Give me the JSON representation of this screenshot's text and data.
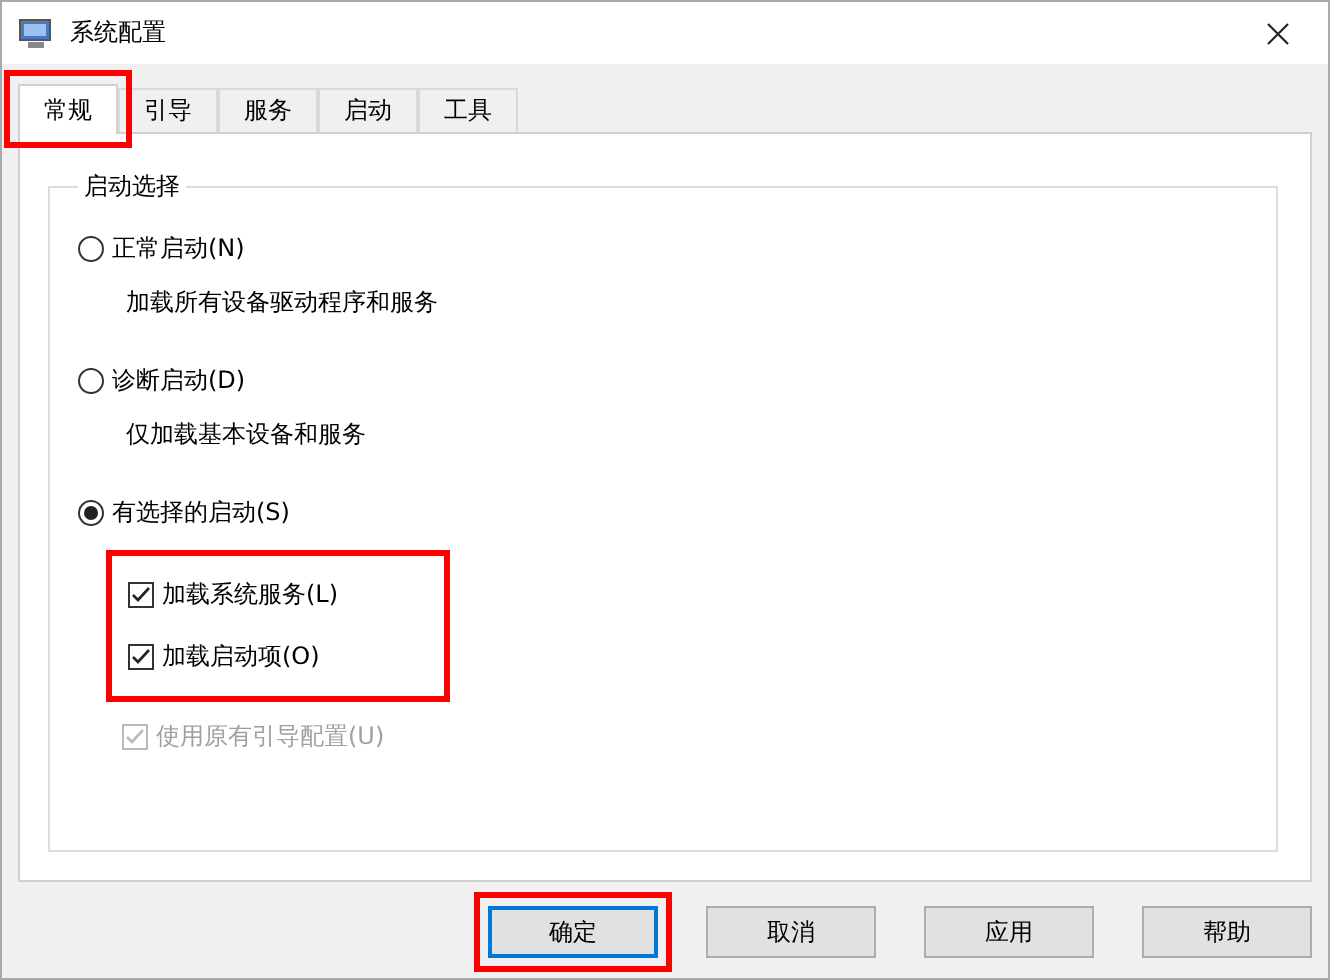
{
  "window": {
    "title": "系统配置"
  },
  "tabs": [
    {
      "label": "常规",
      "selected": true,
      "highlighted": true
    },
    {
      "label": "引导",
      "selected": false,
      "highlighted": false
    },
    {
      "label": "服务",
      "selected": false,
      "highlighted": false
    },
    {
      "label": "启动",
      "selected": false,
      "highlighted": false
    },
    {
      "label": "工具",
      "selected": false,
      "highlighted": false
    }
  ],
  "group": {
    "title": "启动选择",
    "options": [
      {
        "label": "正常启动(N)",
        "description": "加载所有设备驱动程序和服务",
        "selected": false
      },
      {
        "label": "诊断启动(D)",
        "description": "仅加载基本设备和服务",
        "selected": false
      },
      {
        "label": "有选择的启动(S)",
        "selected": true
      }
    ],
    "checkbox_groups": [
      {
        "highlighted": true,
        "items": [
          {
            "label": "加载系统服务(L)",
            "checked": true,
            "disabled": false
          },
          {
            "label": "加载启动项(O)",
            "checked": true,
            "disabled": false
          }
        ]
      },
      {
        "highlighted": false,
        "items": [
          {
            "label": "使用原有引导配置(U)",
            "checked": true,
            "disabled": true
          }
        ]
      }
    ]
  },
  "buttons": [
    {
      "label": "确定",
      "default": true,
      "highlighted": true
    },
    {
      "label": "取消",
      "default": false,
      "highlighted": false
    },
    {
      "label": "应用",
      "default": false,
      "highlighted": false
    },
    {
      "label": "帮助",
      "default": false,
      "highlighted": false
    }
  ]
}
